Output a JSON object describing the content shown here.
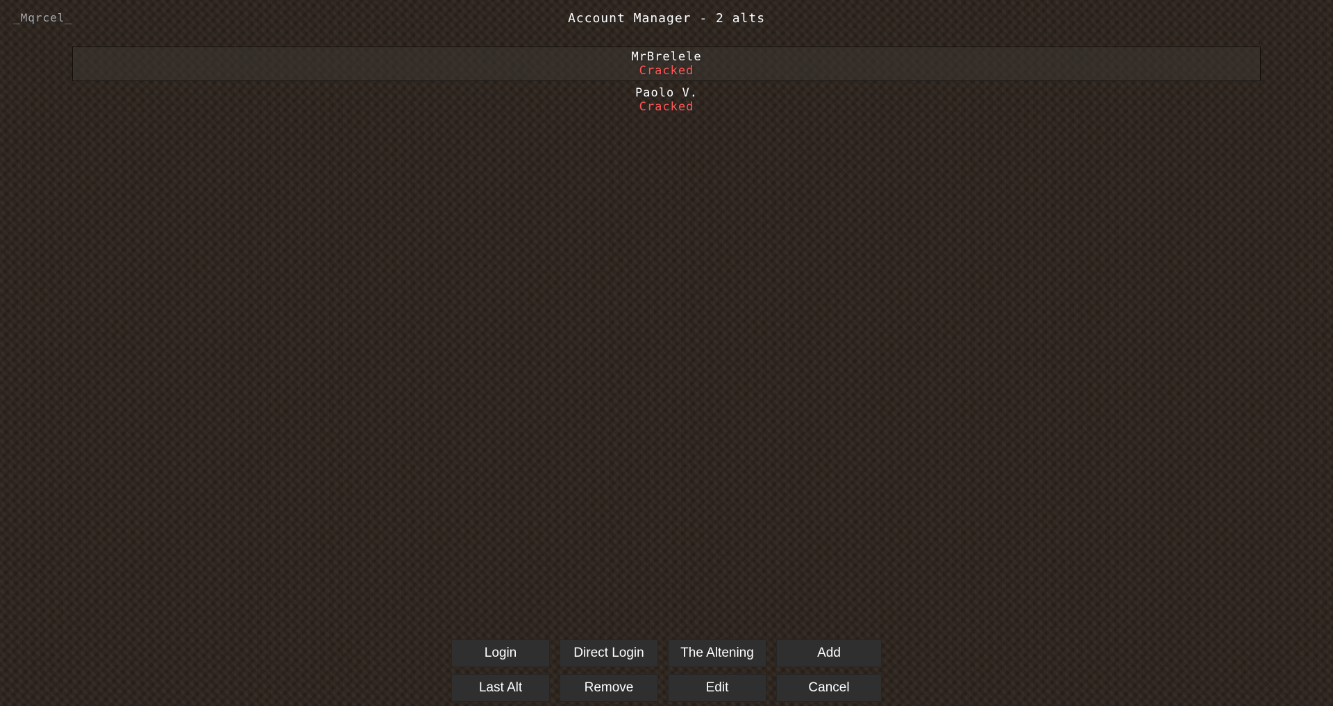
{
  "header": {
    "username": "_Mqrcel_",
    "title": "Account Manager - 2 alts"
  },
  "alts": [
    {
      "name": "MrBrelele",
      "status": "Cracked",
      "selected": true
    },
    {
      "name": "Paolo V.",
      "status": "Cracked",
      "selected": false
    }
  ],
  "buttons": {
    "login": "Login",
    "direct_login": "Direct Login",
    "the_altening": "The Altening",
    "add": "Add",
    "last_alt": "Last Alt",
    "remove": "Remove",
    "edit": "Edit",
    "cancel": "Cancel"
  },
  "colors": {
    "status_cracked": "#ff5555",
    "username_text": "#a8a8a8",
    "button_bg": "#2f2f2f"
  }
}
